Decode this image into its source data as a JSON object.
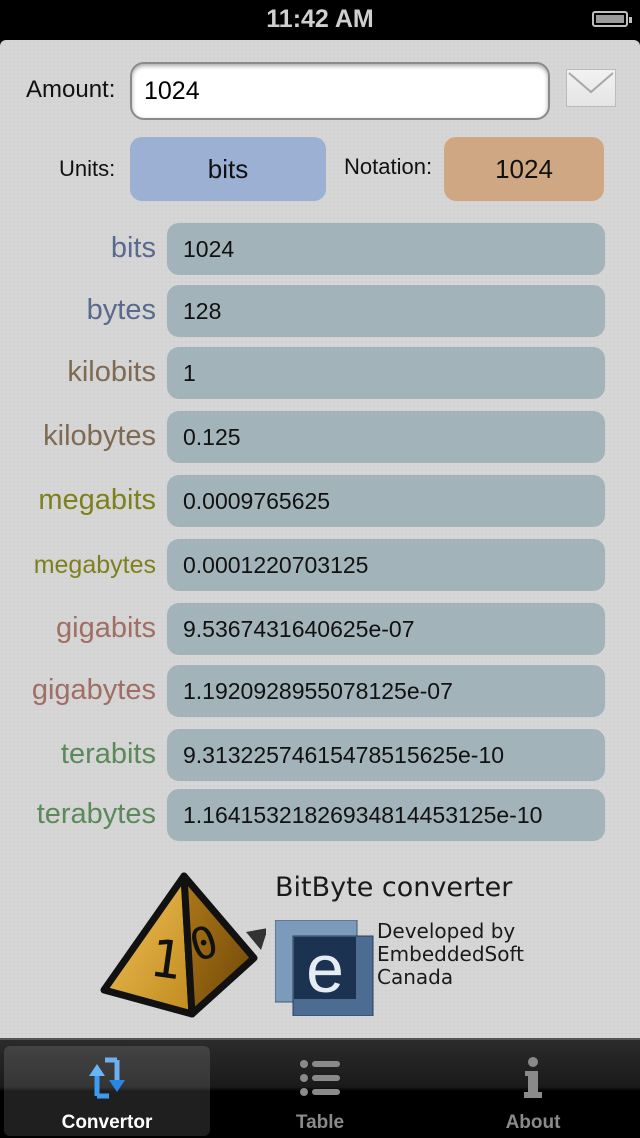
{
  "status_bar": {
    "time": "11:42 AM",
    "battery": "full"
  },
  "amount": {
    "label": "Amount:",
    "value": "1024"
  },
  "mail_icon": "envelope-icon",
  "units": {
    "label": "Units:",
    "value": "bits"
  },
  "notation": {
    "label": "Notation:",
    "value": "1024"
  },
  "conversions": [
    {
      "unit": "bits",
      "value": "1024",
      "color": "#5a6a8e"
    },
    {
      "unit": "bytes",
      "value": "128",
      "color": "#5a6a8e"
    },
    {
      "unit": "kilobits",
      "value": "1",
      "color": "#7e6a52"
    },
    {
      "unit": "kilobytes",
      "value": "0.125",
      "color": "#7e6a52"
    },
    {
      "unit": "megabits",
      "value": "0.0009765625",
      "color": "#7f7f1c"
    },
    {
      "unit": "megabytes",
      "value": "0.0001220703125",
      "color": "#7f7f1c"
    },
    {
      "unit": "gigabits",
      "value": "9.5367431640625e-07",
      "color": "#a06e64"
    },
    {
      "unit": "gigabytes",
      "value": "1.1920928955078125e-07",
      "color": "#a06e64"
    },
    {
      "unit": "terabits",
      "value": "9.31322574615478515625e-10",
      "color": "#5a8a5a"
    },
    {
      "unit": "terabytes",
      "value": "1.16415321826934814453125e-10",
      "color": "#5a8a5a"
    }
  ],
  "branding": {
    "app_title": "BitByte converter",
    "dev_line1": "Developed by",
    "dev_line2": "EmbeddedSoft",
    "dev_line3": "Canada",
    "die_label": "10",
    "company_logo_letter": "e"
  },
  "tab_bar": {
    "tabs": [
      {
        "label": "Convertor",
        "icon": "convert-arrows-icon",
        "active": true
      },
      {
        "label": "Table",
        "icon": "list-icon",
        "active": false
      },
      {
        "label": "About",
        "icon": "info-icon",
        "active": false
      }
    ]
  }
}
